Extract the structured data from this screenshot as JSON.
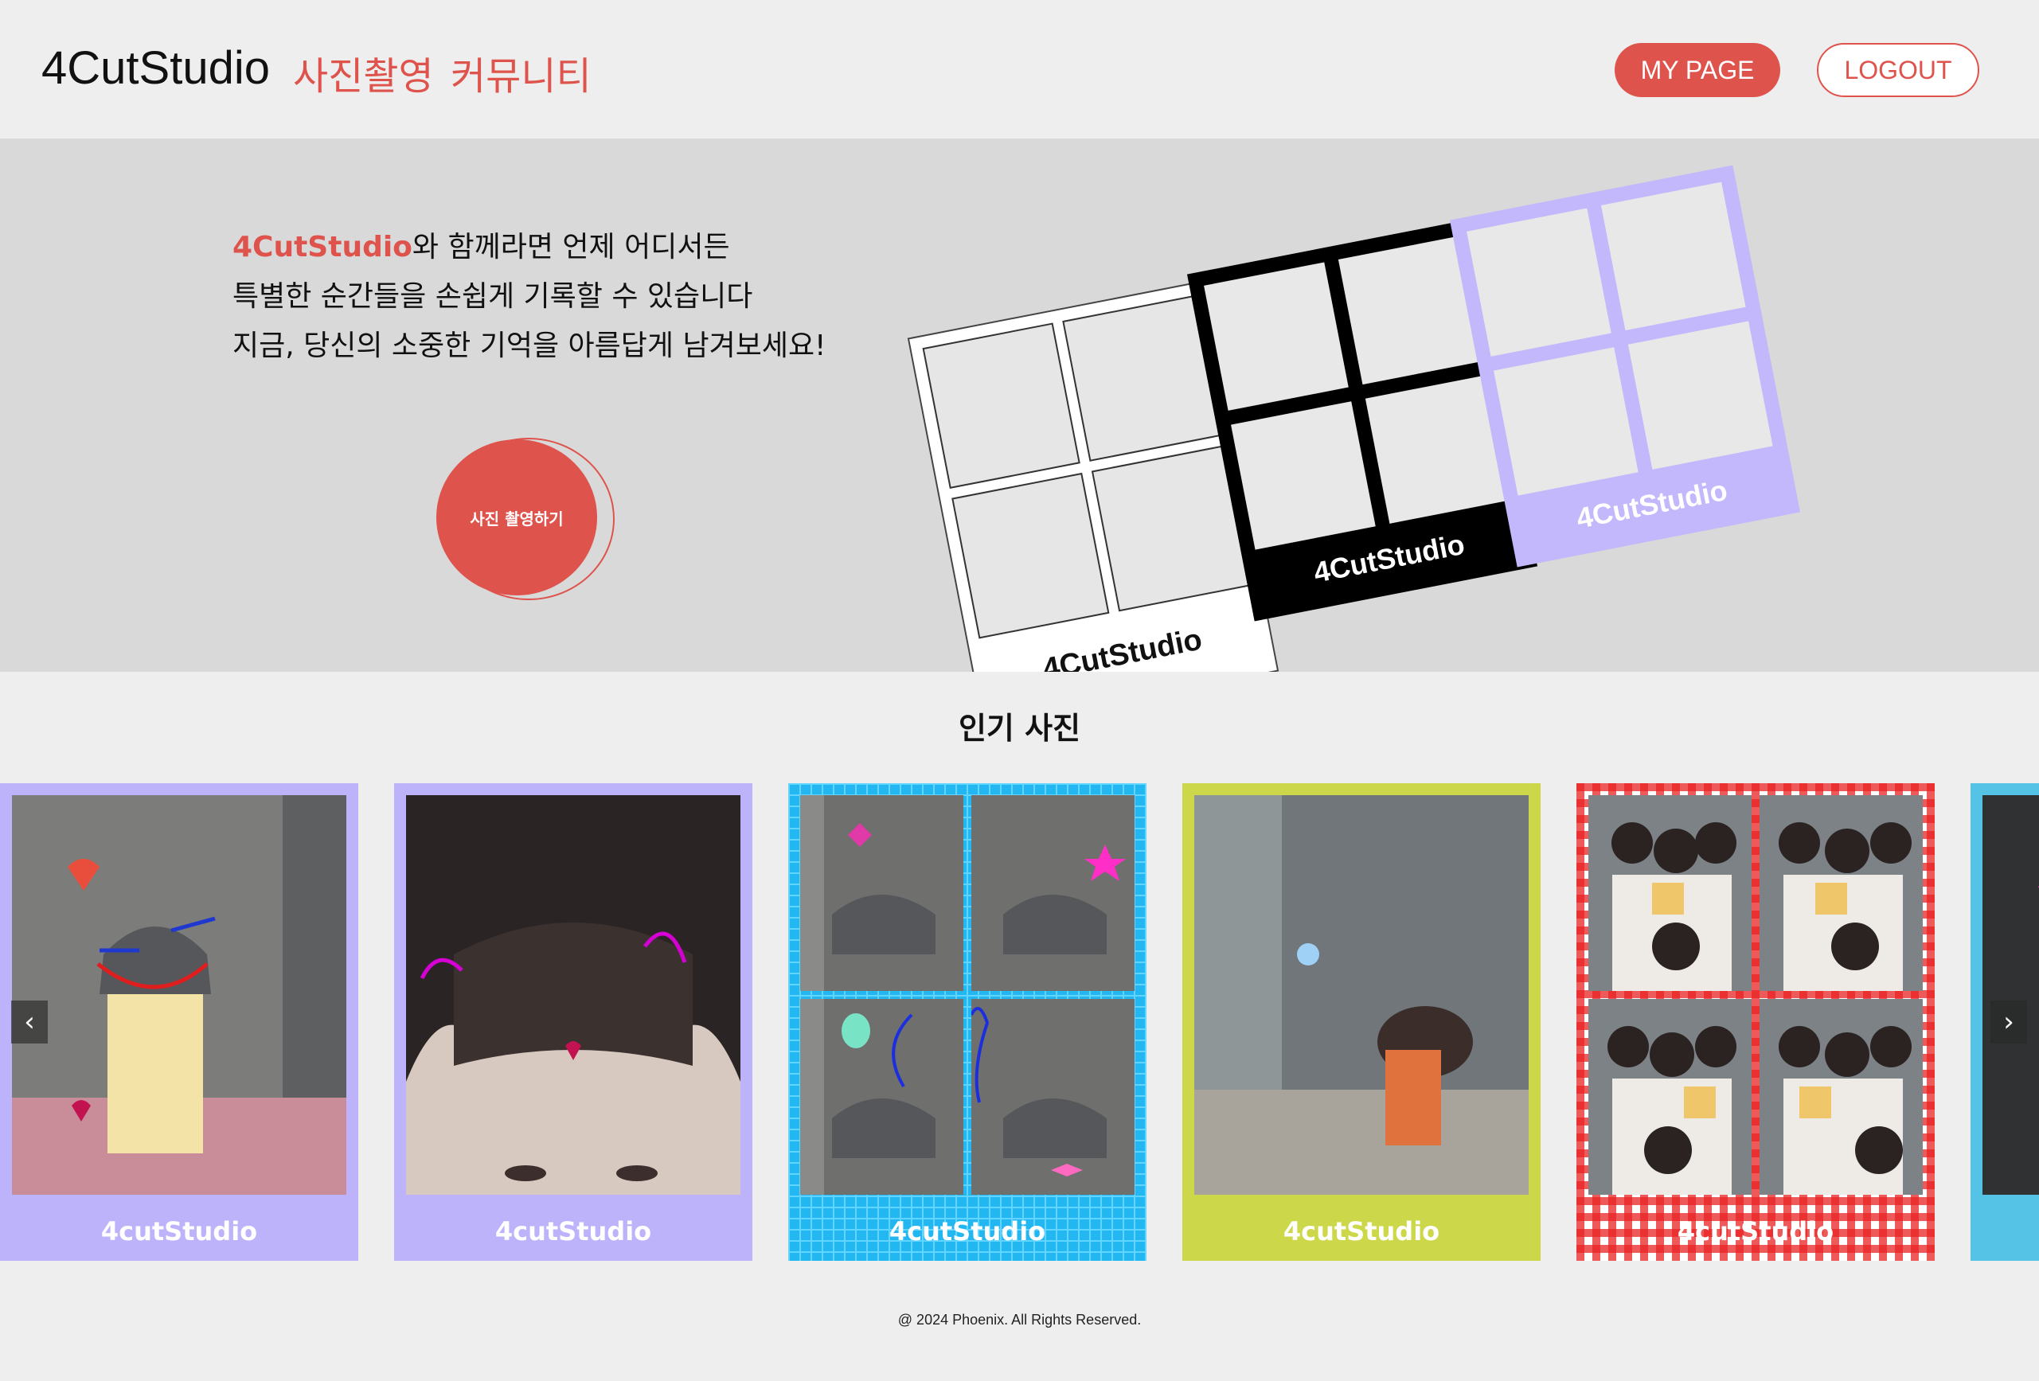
{
  "header": {
    "logo": "4CutStudio",
    "nav": [
      "사진촬영",
      "커뮤니티"
    ],
    "mypage_label": "MY PAGE",
    "logout_label": "LOGOUT"
  },
  "hero": {
    "brand": "4CutStudio",
    "line1_rest": "와 함께라면 언제 어디서든",
    "line2": "특별한 순간들을 손쉽게 기록할 수 있습니다",
    "line3": "지금, 당신의 소중한 기억을 아름답게 남겨보세요!",
    "cta_label": "사진 촬영하기",
    "frames": [
      {
        "label": "4CutStudio",
        "color": "#ffffff"
      },
      {
        "label": "4CutStudio",
        "color": "#000000"
      },
      {
        "label": "4CutStudio",
        "color": "#c2b8fb"
      }
    ]
  },
  "popular": {
    "title": "인기 사진",
    "cards": [
      {
        "label": "4cutStudio",
        "frame_color": "#bdb3fb"
      },
      {
        "label": "4cutStudio",
        "frame_color": "#bdb3fb"
      },
      {
        "label": "4cutStudio",
        "frame_color": "#22b7f0"
      },
      {
        "label": "4cutStudio",
        "frame_color": "#ccd74a"
      },
      {
        "label": "4cutStudio",
        "frame_color": "#e82222"
      },
      {
        "label": "",
        "frame_color": "#55c3e6"
      }
    ],
    "prev_icon": "‹",
    "next_icon": "›"
  },
  "footer": {
    "copyright": "@ 2024 Phoenix. All Rights Reserved."
  },
  "colors": {
    "accent": "#de534c",
    "header_bg": "#eeeeee",
    "hero_bg": "#d9d9d9"
  }
}
